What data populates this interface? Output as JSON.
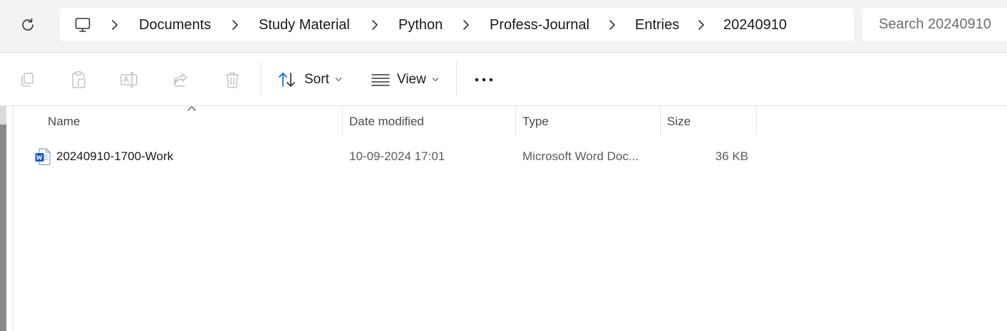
{
  "breadcrumb": {
    "items": [
      "Documents",
      "Study Material",
      "Python",
      "Profess-Journal",
      "Entries",
      "20240910"
    ]
  },
  "search": {
    "placeholder": "Search 20240910"
  },
  "toolbar": {
    "sort_label": "Sort",
    "view_label": "View",
    "more_label": "•••"
  },
  "columns": {
    "name": "Name",
    "date": "Date modified",
    "type": "Type",
    "size": "Size"
  },
  "files": [
    {
      "name": "20240910-1700-Work",
      "date": "10-09-2024 17:01",
      "type": "Microsoft Word Doc...",
      "size": "36 KB",
      "icon": "word-doc-icon"
    }
  ],
  "colors": {
    "word_blue": "#185abd",
    "accent": "#0f6cbd"
  }
}
